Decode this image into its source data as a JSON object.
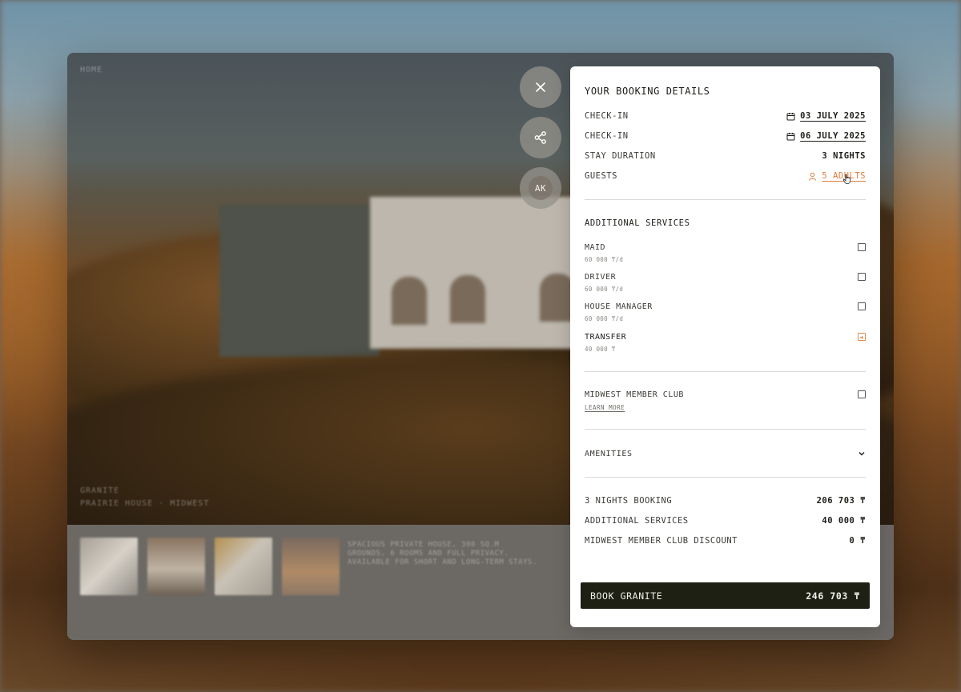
{
  "window": {
    "hero_label": "HOME",
    "hero_caption_line1": "GRANITE",
    "hero_caption_line2": "PRAIRIE HOUSE · MIDWEST",
    "gallery_text": "SPACIOUS PRIVATE HOUSE, 300 SQ.M GROUNDS, 6 ROOMS AND FULL PRIVACY. AVAILABLE FOR SHORT AND LONG-TERM STAYS."
  },
  "actions": {
    "close_icon": "close-icon",
    "share_icon": "share-icon",
    "avatar_initials": "AK"
  },
  "booking": {
    "title": "YOUR BOOKING DETAILS",
    "checkin_label": "CHECK-IN",
    "checkin_date": "03 JULY 2025",
    "checkout_label": "CHECK-IN",
    "checkout_date": "06 JULY 2025",
    "duration_label": "STAY DURATION",
    "duration_value": "3 NIGHTS",
    "guests_label": "GUESTS",
    "guests_value": "5 ADULTS"
  },
  "services": {
    "title": "ADDITIONAL SERVICES",
    "items": [
      {
        "name": "MAID",
        "price": "60 000 ₸/d",
        "checked": false
      },
      {
        "name": "DRIVER",
        "price": "60 000 ₸/d",
        "checked": false
      },
      {
        "name": "HOUSE MANAGER",
        "price": "60 000 ₸/d",
        "checked": false
      },
      {
        "name": "TRANSFER",
        "price": "40 000 ₸",
        "checked": true
      }
    ]
  },
  "club": {
    "name": "MIDWEST MEMBER CLUB",
    "link": "LEARN MORE",
    "checked": false
  },
  "amenities": {
    "label": "AMENITIES"
  },
  "summary": {
    "rows": [
      {
        "label": "3 NIGHTS BOOKING",
        "value": "206 703 ₸"
      },
      {
        "label": "ADDITIONAL SERVICES",
        "value": "40 000 ₸"
      },
      {
        "label": "MIDWEST MEMBER CLUB DISCOUNT",
        "value": "0 ₸"
      }
    ]
  },
  "book_button": {
    "label": "BOOK GRANITE",
    "amount": "246 703 ₸"
  },
  "colors": {
    "accent": "#e07a3a",
    "button_dark": "#1d2013",
    "panel_bg": "#ffffff"
  }
}
